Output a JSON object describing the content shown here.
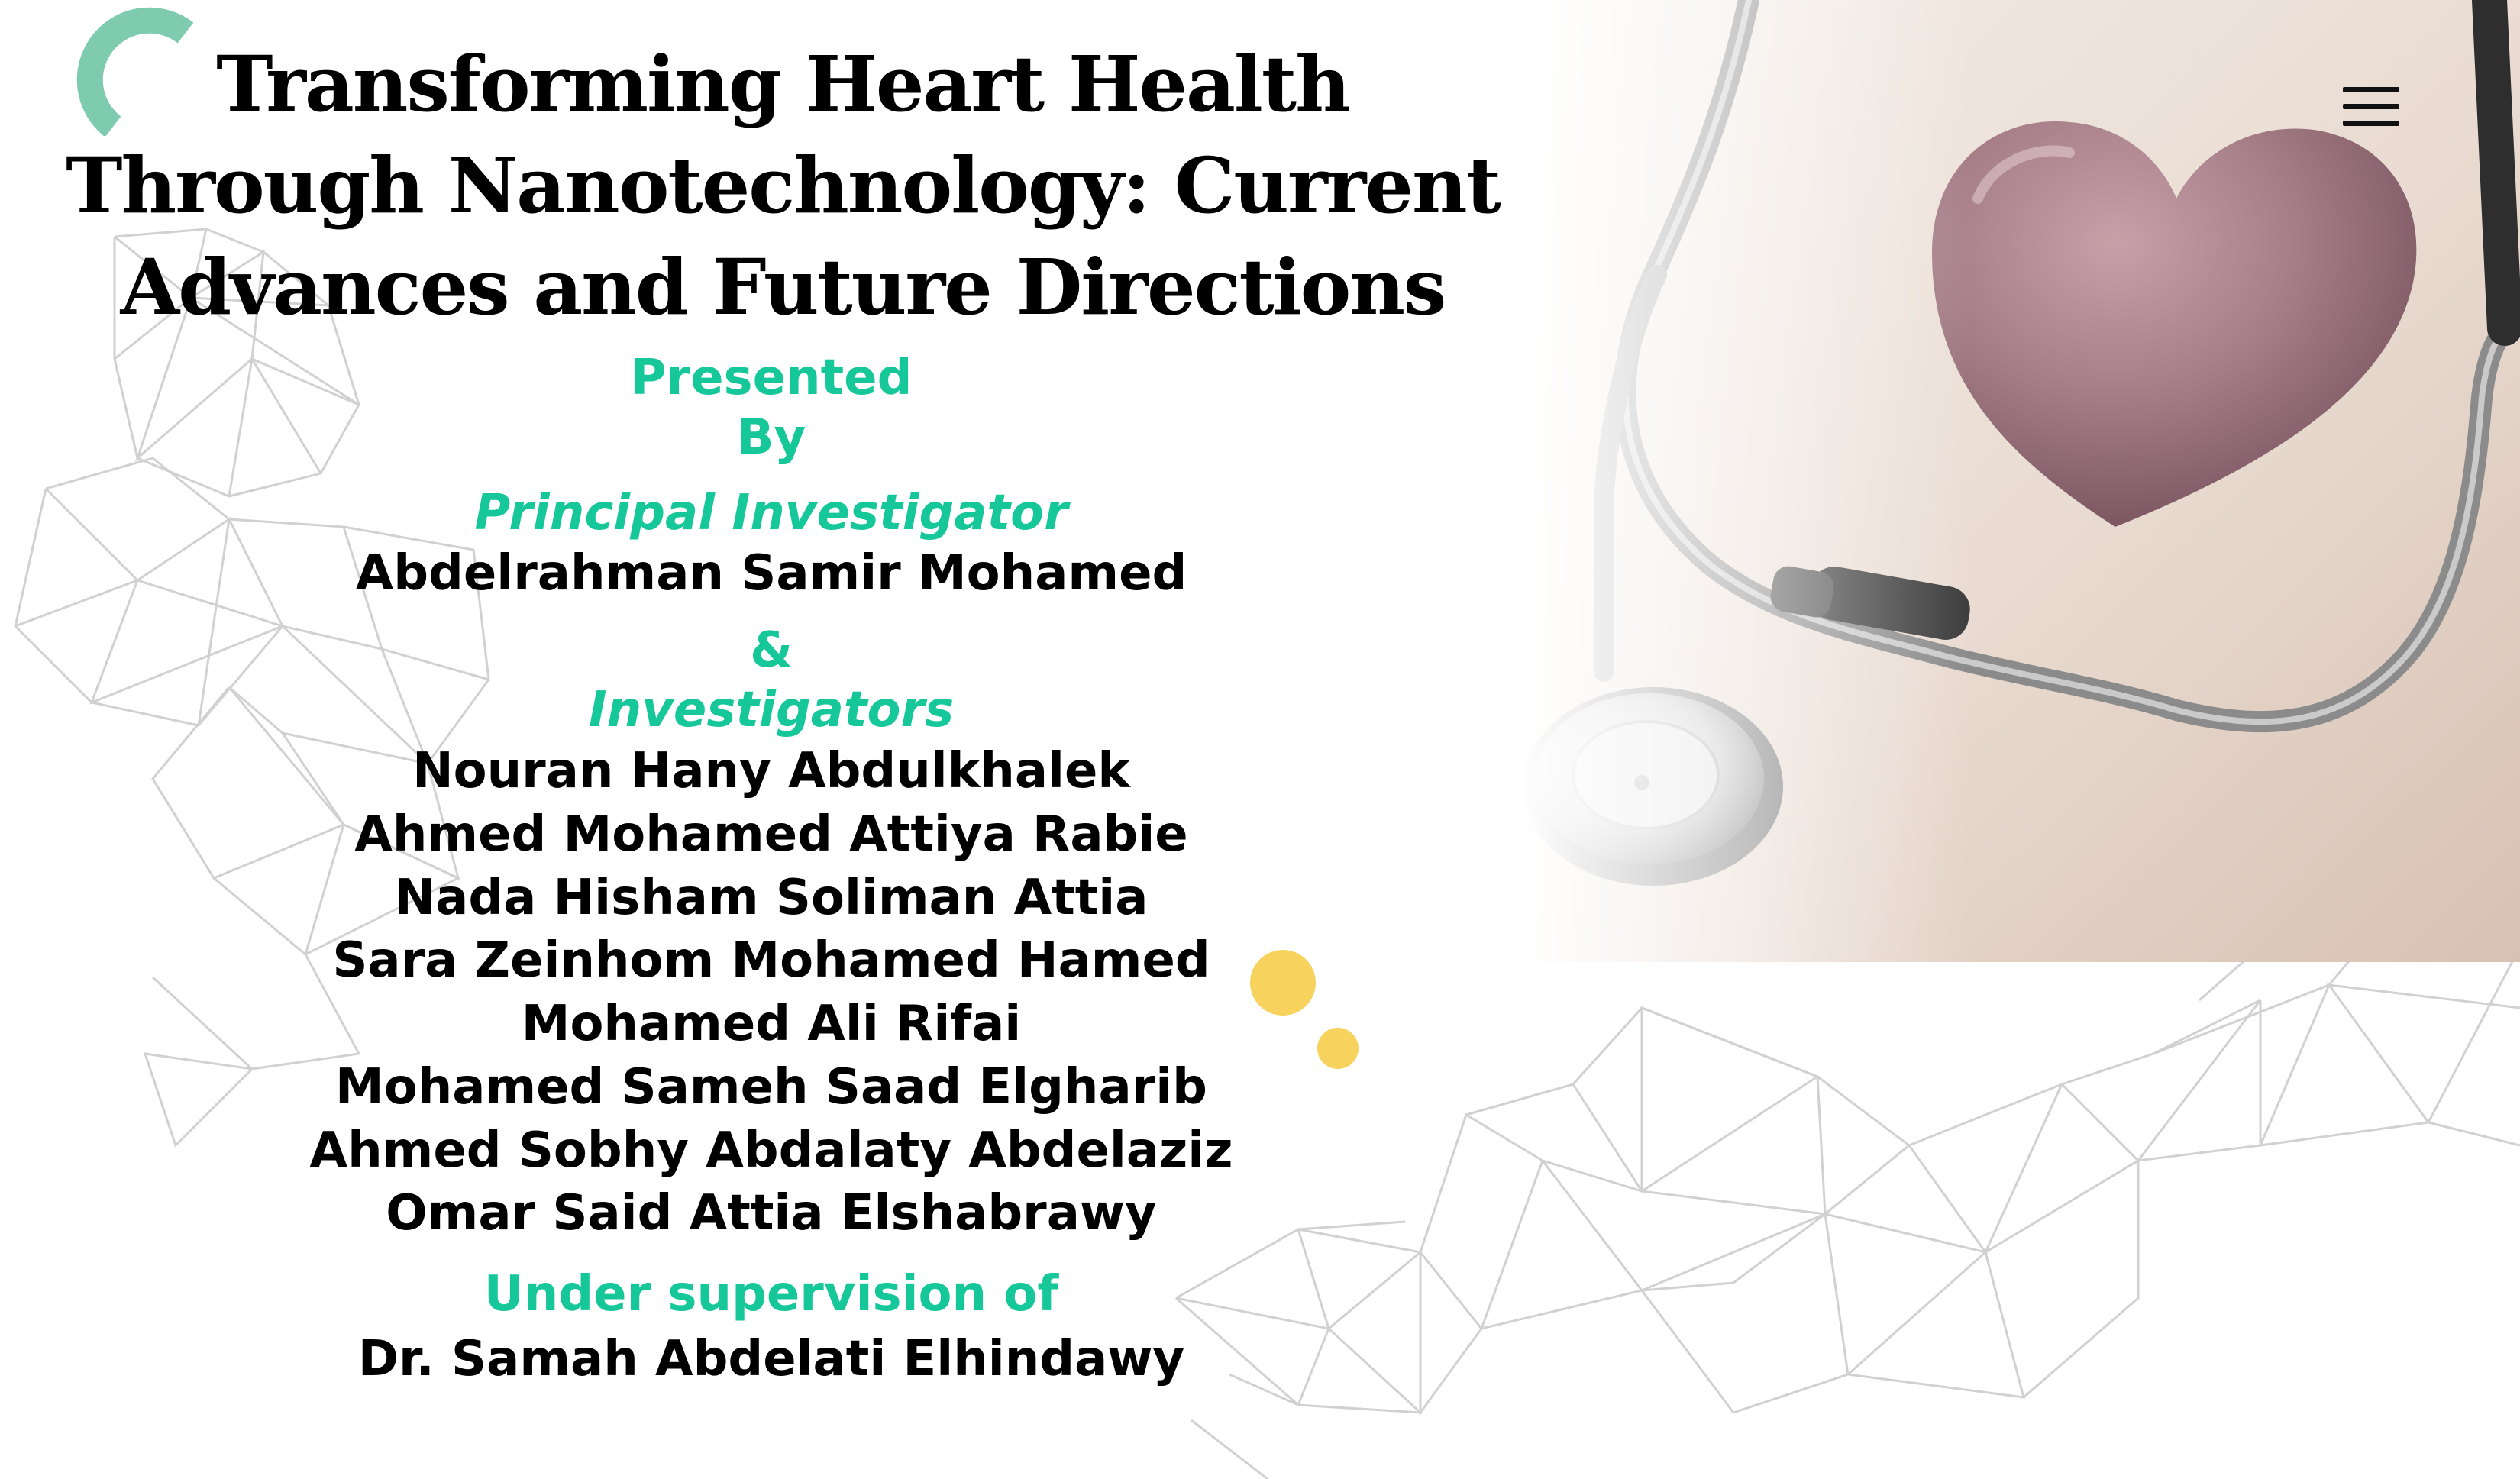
{
  "title": "Transforming Heart Health Through Nanotechnology: Current Advances and Future Directions",
  "presented_label": "Presented",
  "by_label": "By",
  "principal_label": "Principal Investigator",
  "principal_name": "Abdelrahman Samir Mohamed",
  "ampersand": "&",
  "investigators_label": "Investigators",
  "investigators": [
    "Nouran Hany Abdulkhalek",
    "Ahmed Mohamed Attiya Rabie",
    "Nada Hisham Soliman Attia",
    "Sara Zeinhom Mohamed Hamed",
    "Mohamed Ali Rifai",
    "Mohamed Sameh Saad Elgharib",
    "Ahmed Sobhy Abdalaty Abdelaziz",
    "Omar Said Attia Elshabrawy"
  ],
  "supervision_label": "Under supervision of",
  "supervisor_name": "Dr. Samah Abdelati Elhindawy",
  "colors": {
    "accent": "#16c79a",
    "text": "#000000",
    "dot": "#f7d25c",
    "logo_arc": "#7fcbb0"
  },
  "icons": {
    "menu": "hamburger-menu-icon"
  }
}
